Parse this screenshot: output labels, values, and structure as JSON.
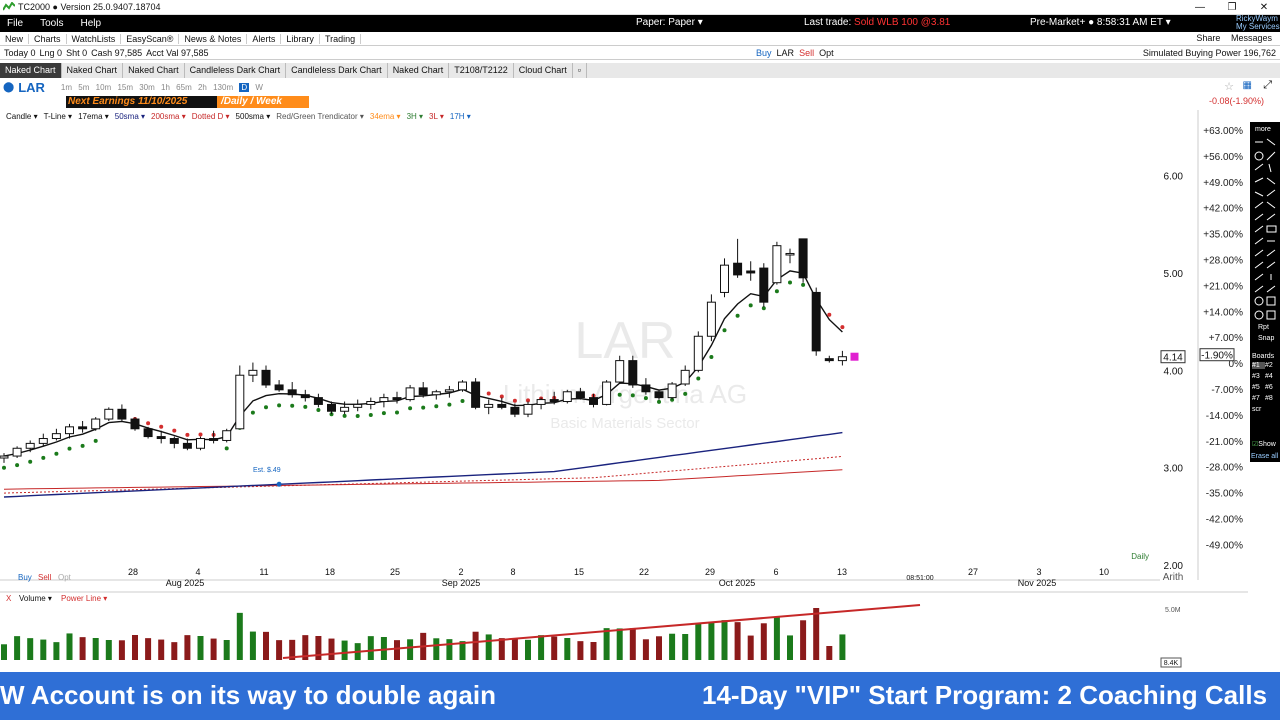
{
  "window": {
    "title": "TC2000 ● Version 25.0.9407.18704",
    "controls": [
      "—",
      "❐",
      "✕"
    ]
  },
  "menu": {
    "items": [
      "File",
      "Tools",
      "Help"
    ],
    "paper": "Paper: Paper ▾",
    "last_trade_label": "Last trade:",
    "last_trade_value": "Sold WLB 100 @3.81",
    "premarket": "Pre-Market+ ● 8:58:31 AM ET ▾",
    "user_line1": "RickyWaym",
    "user_line2": "My Services"
  },
  "toolbar": {
    "items": [
      "New",
      "Charts",
      "WatchLists",
      "EasyScan®",
      "News & Notes",
      "Alerts",
      "Library",
      "Trading"
    ],
    "share": "Share",
    "messages": "Messages"
  },
  "account": {
    "today": "Today 0",
    "lng": "Lng 0",
    "sht": "Sht 0",
    "cash": "Cash 97,585",
    "acct_val": "Acct Val 97,585",
    "buy": "Buy",
    "symbol": "LAR",
    "sell": "Sell",
    "opt": "Opt",
    "buying_power": "Simulated Buying Power 196,762"
  },
  "tabs": [
    "Naked Chart",
    "Naked Chart",
    "Naked Chart",
    "Candleless Dark Chart",
    "Candleless Dark Chart",
    "Naked Chart",
    "T2108/T2122",
    "Cloud Chart"
  ],
  "symbol_bar": {
    "symbol": "LAR",
    "timeframes": [
      "1m",
      "5m",
      "10m",
      "15m",
      "30m",
      "1h",
      "65m",
      "2h",
      "130m",
      "D",
      "W"
    ]
  },
  "earnings": {
    "next": "Next Earnings 11/10/2025",
    "period": "/Daily / Week"
  },
  "change_top": "-0.08(-1.90%)",
  "indicators": [
    {
      "label": "Candle ▾",
      "color": "#111111"
    },
    {
      "label": "T-Line ▾",
      "color": "#111111"
    },
    {
      "label": "17ema ▾",
      "color": "#111111"
    },
    {
      "label": "50sma ▾",
      "color": "#1a237e"
    },
    {
      "label": "200sma ▾",
      "color": "#c62828"
    },
    {
      "label": "Dotted D ▾",
      "color": "#c62828"
    },
    {
      "label": "500sma ▾",
      "color": "#111111"
    },
    {
      "label": "Red/Green Trendicator ▾",
      "color": "#555555"
    },
    {
      "label": "34ema ▾",
      "color": "#ff8c1a"
    },
    {
      "label": "3H ▾",
      "color": "#2e7d32"
    },
    {
      "label": "3L ▾",
      "color": "#c62828"
    },
    {
      "label": "17H ▾",
      "color": "#1565c0"
    }
  ],
  "watermark": {
    "symbol": "LAR",
    "name": "Lithium Argentina AG",
    "sector": "Basic Materials Sector"
  },
  "chart_data": {
    "type": "candlestick",
    "symbol": "LAR",
    "timeframe": "Daily",
    "price_axis": [
      6.0,
      5.0,
      4.0,
      3.0,
      2.0
    ],
    "price_range": [
      1.95,
      6.55
    ],
    "pct_axis": [
      "+63.00%",
      "+56.00%",
      "+49.00%",
      "+42.00%",
      "+35.00%",
      "+28.00%",
      "+21.00%",
      "+14.00%",
      "+7.00%",
      "0%",
      "-7.00%",
      "-14.00%",
      "-21.00%",
      "-28.00%",
      "-35.00%",
      "-42.00%",
      "-49.00%"
    ],
    "last_price": "4.14",
    "last_change": "-1.90%",
    "x_ticks": [
      "28",
      "4",
      "11",
      "18",
      "25",
      "2",
      "8",
      "15",
      "22",
      "29",
      "6",
      "13",
      "27",
      "3",
      "10"
    ],
    "month_labels": [
      "Aug 2025",
      "Sep 2025",
      "Oct 2025",
      "Nov 2025"
    ],
    "time_label": "08:51:00",
    "scale_label": "Arith",
    "daily_label": "Daily",
    "annotation": "Est. $.49",
    "candles": [
      [
        3.1,
        3.15,
        3.05,
        3.12
      ],
      [
        3.12,
        3.22,
        3.1,
        3.2
      ],
      [
        3.2,
        3.28,
        3.16,
        3.25
      ],
      [
        3.25,
        3.35,
        3.22,
        3.3
      ],
      [
        3.3,
        3.4,
        3.28,
        3.35
      ],
      [
        3.35,
        3.45,
        3.3,
        3.42
      ],
      [
        3.42,
        3.48,
        3.36,
        3.4
      ],
      [
        3.4,
        3.52,
        3.38,
        3.5
      ],
      [
        3.5,
        3.62,
        3.48,
        3.6
      ],
      [
        3.6,
        3.65,
        3.48,
        3.5
      ],
      [
        3.5,
        3.52,
        3.38,
        3.4
      ],
      [
        3.4,
        3.42,
        3.3,
        3.32
      ],
      [
        3.32,
        3.38,
        3.25,
        3.3
      ],
      [
        3.3,
        3.32,
        3.2,
        3.25
      ],
      [
        3.25,
        3.3,
        3.18,
        3.2
      ],
      [
        3.2,
        3.32,
        3.18,
        3.3
      ],
      [
        3.3,
        3.38,
        3.25,
        3.28
      ],
      [
        3.28,
        3.4,
        3.26,
        3.38
      ],
      [
        3.4,
        4.05,
        3.4,
        3.95
      ],
      [
        3.95,
        4.08,
        3.88,
        4.0
      ],
      [
        4.0,
        4.05,
        3.82,
        3.85
      ],
      [
        3.85,
        3.9,
        3.78,
        3.8
      ],
      [
        3.8,
        3.88,
        3.72,
        3.75
      ],
      [
        3.75,
        3.8,
        3.68,
        3.72
      ],
      [
        3.72,
        3.76,
        3.62,
        3.65
      ],
      [
        3.65,
        3.68,
        3.55,
        3.58
      ],
      [
        3.58,
        3.68,
        3.55,
        3.62
      ],
      [
        3.62,
        3.7,
        3.58,
        3.65
      ],
      [
        3.65,
        3.72,
        3.6,
        3.68
      ],
      [
        3.68,
        3.76,
        3.62,
        3.72
      ],
      [
        3.72,
        3.78,
        3.66,
        3.7
      ],
      [
        3.7,
        3.85,
        3.68,
        3.82
      ],
      [
        3.82,
        3.88,
        3.72,
        3.75
      ],
      [
        3.75,
        3.8,
        3.7,
        3.78
      ],
      [
        3.78,
        3.84,
        3.72,
        3.8
      ],
      [
        3.8,
        3.9,
        3.78,
        3.88
      ],
      [
        3.88,
        3.92,
        3.6,
        3.62
      ],
      [
        3.62,
        3.7,
        3.55,
        3.65
      ],
      [
        3.65,
        3.72,
        3.6,
        3.62
      ],
      [
        3.62,
        3.66,
        3.52,
        3.55
      ],
      [
        3.55,
        3.68,
        3.52,
        3.65
      ],
      [
        3.65,
        3.72,
        3.6,
        3.7
      ],
      [
        3.7,
        3.78,
        3.65,
        3.68
      ],
      [
        3.68,
        3.8,
        3.66,
        3.78
      ],
      [
        3.78,
        3.82,
        3.7,
        3.72
      ],
      [
        3.72,
        3.76,
        3.62,
        3.65
      ],
      [
        3.65,
        3.9,
        3.64,
        3.88
      ],
      [
        3.88,
        4.15,
        3.86,
        4.1
      ],
      [
        4.1,
        4.15,
        3.82,
        3.85
      ],
      [
        3.85,
        3.92,
        3.75,
        3.78
      ],
      [
        3.78,
        3.8,
        3.7,
        3.72
      ],
      [
        3.72,
        3.88,
        3.7,
        3.86
      ],
      [
        3.86,
        4.05,
        3.84,
        4.0
      ],
      [
        4.0,
        4.4,
        3.98,
        4.35
      ],
      [
        4.35,
        4.78,
        4.3,
        4.7
      ],
      [
        4.8,
        5.15,
        4.75,
        5.08
      ],
      [
        5.1,
        5.35,
        4.95,
        4.98
      ],
      [
        5.02,
        5.12,
        4.92,
        5.0
      ],
      [
        5.05,
        5.1,
        4.65,
        4.7
      ],
      [
        4.9,
        5.32,
        4.88,
        5.28
      ],
      [
        5.2,
        5.25,
        5.1,
        5.2
      ],
      [
        5.35,
        5.35,
        4.9,
        4.95
      ],
      [
        4.8,
        4.85,
        4.15,
        4.2
      ],
      [
        4.12,
        4.15,
        4.08,
        4.1
      ],
      [
        4.1,
        4.2,
        4.05,
        4.14
      ]
    ],
    "volume_label": "Volume ▾",
    "power_line_label": "Power Line ▾",
    "volume_axis_label": "5.0M",
    "volume_last_label": "8.4K"
  },
  "chart_buttons": {
    "buy": "Buy",
    "sell": "Sell",
    "opt": "Opt"
  },
  "side_panel": {
    "more": "more",
    "rpt": "Rpt",
    "snap": "Snap",
    "boards": "Boards",
    "board_items": [
      "#1",
      "#2",
      "#3",
      "#4",
      "#5",
      "#6",
      "#7",
      "#8"
    ],
    "scr": "scr",
    "show": "Show",
    "erase_all": "Erase all"
  },
  "ticker": {
    "text1": "W Account is on its way to double again",
    "text2": "14-Day \"VIP\" Start Program:  2 Coaching Calls"
  }
}
